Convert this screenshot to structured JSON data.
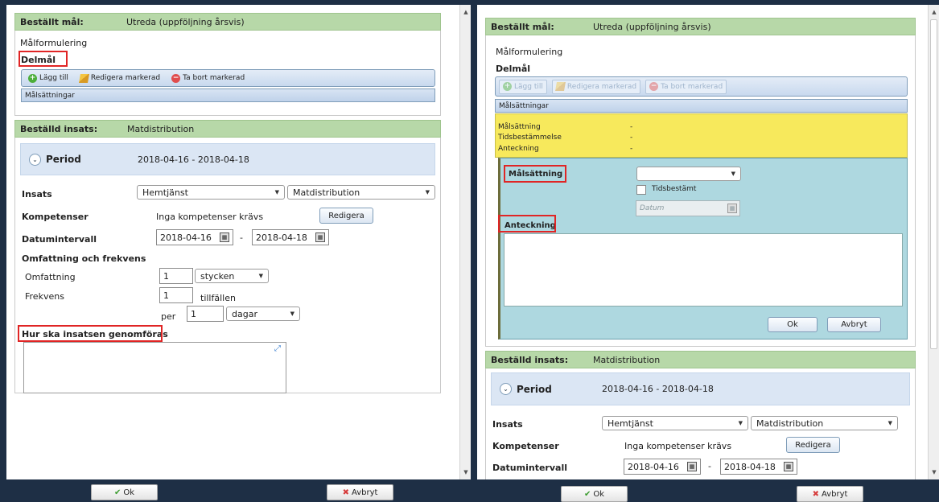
{
  "left": {
    "goal_header": {
      "label": "Beställt mål:",
      "value": "Utreda (uppföljning årsvis)"
    },
    "malformulering": "Målformulering",
    "delmal": "Delmål",
    "toolbar": {
      "add": "Lägg till",
      "edit": "Redigera markerad",
      "remove": "Ta bort markerad"
    },
    "malsattningar_bar": "Målsättningar",
    "insats_header": {
      "label": "Beställd insats:",
      "value": "Matdistribution"
    },
    "period": {
      "label": "Period",
      "value": "2018-04-16 - 2018-04-18"
    },
    "insats": {
      "label": "Insats",
      "select1": "Hemtjänst",
      "select2": "Matdistribution"
    },
    "kompetenser": {
      "label": "Kompetenser",
      "value": "Inga kompetenser krävs",
      "button": "Redigera"
    },
    "datumintervall": {
      "label": "Datumintervall",
      "from": "2018-04-16",
      "sep": "-",
      "to": "2018-04-18"
    },
    "omfattning_frekvens": {
      "label": "Omfattning och frekvens",
      "omfattning_label": "Omfattning",
      "omfattning_value": "1",
      "omfattning_unit": "stycken",
      "frekvens_label": "Frekvens",
      "frekvens_value": "1",
      "frekvens_unit": "tillfällen",
      "per_label": "per",
      "per_value": "1",
      "per_unit": "dagar"
    },
    "hur": "Hur ska insatsen genomföras",
    "footer": {
      "ok": "Ok",
      "cancel": "Avbryt"
    }
  },
  "right": {
    "goal_header": {
      "label": "Beställt mål:",
      "value": "Utreda (uppföljning årsvis)"
    },
    "malformulering": "Målformulering",
    "delmal": "Delmål",
    "toolbar": {
      "add": "Lägg till",
      "edit": "Redigera markerad",
      "remove": "Ta bort markerad"
    },
    "malsattningar_bar": "Målsättningar",
    "info_rows": [
      {
        "label": "Målsättning",
        "value": "-"
      },
      {
        "label": "Tidsbestämmelse",
        "value": "-"
      },
      {
        "label": "Anteckning",
        "value": "-"
      }
    ],
    "form": {
      "malsattning_label": "Målsättning",
      "malsattning_select": "",
      "tidsbestamt_label": "Tidsbestämt",
      "datum_placeholder": "Datum",
      "anteckning_label": "Anteckning",
      "ok": "Ok",
      "cancel": "Avbryt"
    },
    "insats_header": {
      "label": "Beställd insats:",
      "value": "Matdistribution"
    },
    "period": {
      "label": "Period",
      "value": "2018-04-16 - 2018-04-18"
    },
    "insats": {
      "label": "Insats",
      "select1": "Hemtjänst",
      "select2": "Matdistribution"
    },
    "kompetenser": {
      "label": "Kompetenser",
      "value": "Inga kompetenser krävs",
      "button": "Redigera"
    },
    "datumintervall": {
      "label": "Datumintervall",
      "from": "2018-04-16",
      "sep": "-",
      "to": "2018-04-18"
    },
    "footer": {
      "ok": "Ok",
      "cancel": "Avbryt"
    }
  },
  "colors": {
    "section_green": "#b7d8a8",
    "info_yellow": "#f7e95c",
    "form_teal": "#aed8e0",
    "highlight_red": "#e02525"
  }
}
